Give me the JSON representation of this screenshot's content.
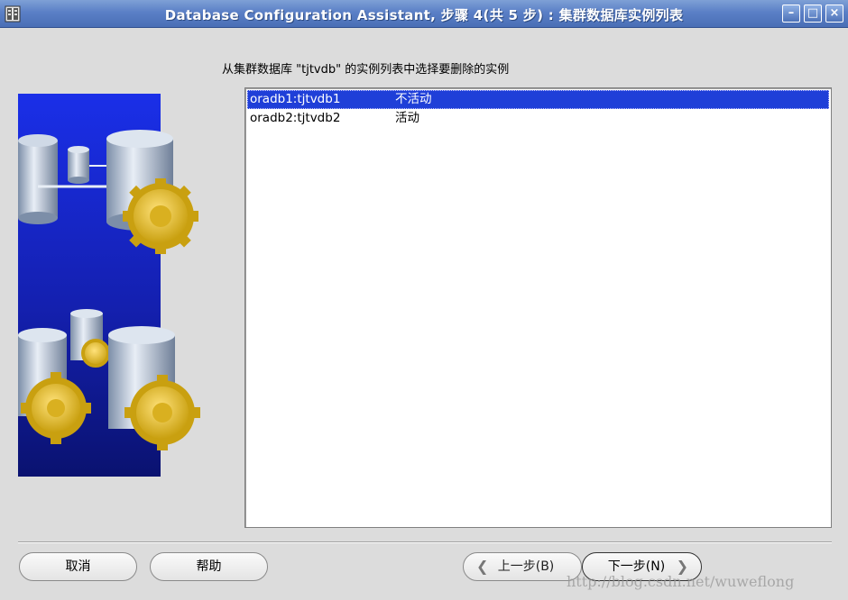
{
  "window": {
    "title": "Database Configuration Assistant, 步骤 4(共 5 步) : 集群数据库实例列表",
    "minimize_glyph": "–",
    "maximize_glyph": "□",
    "close_glyph": "×"
  },
  "instruction": "从集群数据库 \"tjtvdb\" 的实例列表中选择要删除的实例",
  "instances": [
    {
      "name": "oradb1:tjtvdb1",
      "status": "不活动",
      "selected": true
    },
    {
      "name": "oradb2:tjtvdb2",
      "status": "活动",
      "selected": false
    }
  ],
  "buttons": {
    "cancel": "取消",
    "help": "帮助",
    "back": "上一步(B)",
    "next": "下一步(N)"
  },
  "icons": {
    "back": "chevron-left-icon",
    "next": "chevron-right-icon"
  },
  "watermark": "http://blog.csdn.net/wuweflong",
  "colors": {
    "titlebar": "#5a7fc6",
    "selection": "#1f3fd8"
  }
}
